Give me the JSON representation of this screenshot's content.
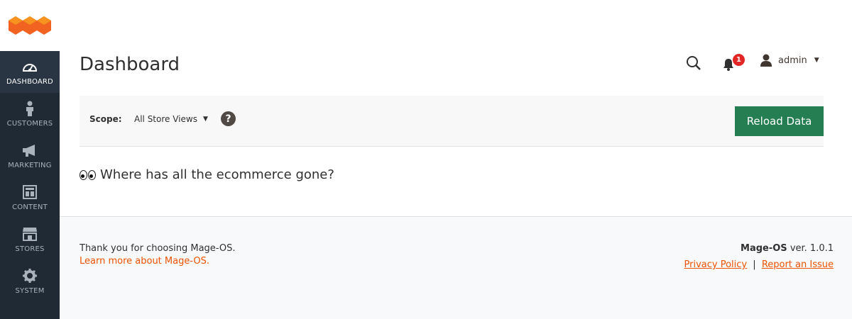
{
  "sidebar": {
    "items": [
      {
        "label": "DASHBOARD",
        "icon": "dashboard-icon",
        "active": true
      },
      {
        "label": "CUSTOMERS",
        "icon": "person-icon"
      },
      {
        "label": "MARKETING",
        "icon": "megaphone-icon"
      },
      {
        "label": "CONTENT",
        "icon": "layout-icon"
      },
      {
        "label": "STORES",
        "icon": "storefront-icon"
      },
      {
        "label": "SYSTEM",
        "icon": "gear-icon"
      }
    ]
  },
  "header": {
    "title": "Dashboard",
    "notifications_count": "1",
    "user_name": "admin"
  },
  "scope": {
    "label": "Scope:",
    "selected": "All Store Views",
    "help": "?"
  },
  "actions": {
    "reload_label": "Reload Data"
  },
  "content": {
    "message": "Where has all the ecommerce gone?"
  },
  "footer": {
    "thanks": "Thank you for choosing Mage-OS.",
    "learn_more": "Learn more about Mage-OS.",
    "brand": "Mage-OS",
    "version": "ver. 1.0.1",
    "privacy": "Privacy Policy",
    "separator": "|",
    "report": "Report an Issue"
  },
  "colors": {
    "sidebar_bg": "#1f2a35",
    "active_item_bg": "#293542",
    "accent_orange": "#eb5202",
    "button_green": "#257e51",
    "badge_red": "#e22626"
  }
}
